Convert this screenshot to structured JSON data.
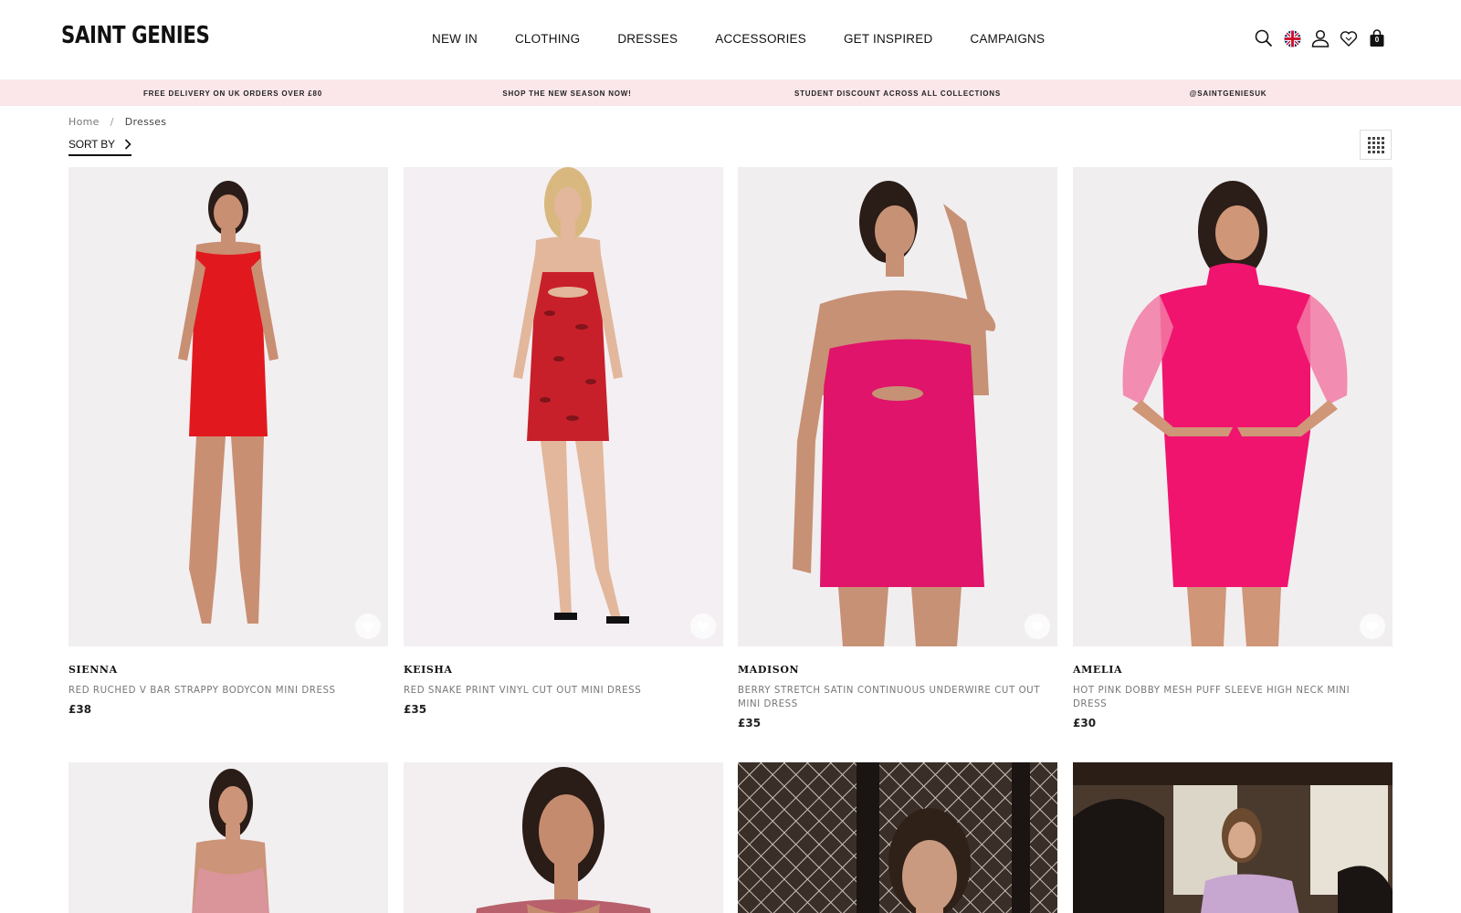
{
  "brand": {
    "logo_text": "SAINT GENIES"
  },
  "nav": {
    "items": [
      {
        "label": "NEW IN"
      },
      {
        "label": "CLOTHING"
      },
      {
        "label": "DRESSES"
      },
      {
        "label": "ACCESSORIES"
      },
      {
        "label": "GET INSPIRED"
      },
      {
        "label": "CAMPAIGNS"
      }
    ]
  },
  "header_icons": {
    "search": "search-icon",
    "flag": "uk-flag-icon",
    "account": "user-icon",
    "wishlist": "heart-icon",
    "bag": "shopping-bag-icon",
    "bag_count": "0"
  },
  "promo": {
    "items": [
      "FREE DELIVERY ON UK ORDERS OVER £80",
      "SHOP THE NEW SEASON NOW!",
      "STUDENT DISCOUNT ACROSS ALL COLLECTIONS",
      "@SAINTGENIESUK"
    ]
  },
  "breadcrumb": {
    "home": "Home",
    "separator": "/",
    "current": "Dresses"
  },
  "sort": {
    "label": "SORT BY"
  },
  "products": [
    {
      "name": "SIENNA",
      "description": "RED RUCHED V BAR STRAPPY BODYCON MINI DRESS",
      "price": "£38",
      "dress_color": "#e1191e"
    },
    {
      "name": "KEISHA",
      "description": "RED SNAKE PRINT VINYL CUT OUT MINI DRESS",
      "price": "£35",
      "dress_color": "#c8202a"
    },
    {
      "name": "MADISON",
      "description": "BERRY STRETCH SATIN CONTINUOUS UNDERWIRE CUT OUT MINI DRESS",
      "price": "£35",
      "dress_color": "#e0146a"
    },
    {
      "name": "AMELIA",
      "description": "HOT PINK DOBBY MESH PUFF SLEEVE HIGH NECK MINI DRESS",
      "price": "£30",
      "dress_color": "#f0146e"
    }
  ],
  "colors": {
    "promo_bg": "#fbe6ea",
    "text": "#111111",
    "muted": "#777777"
  }
}
